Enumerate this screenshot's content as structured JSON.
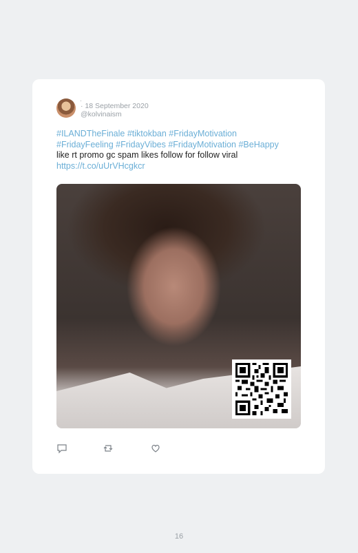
{
  "tweet": {
    "separator": "·",
    "date": "18 September 2020",
    "handle": "@kolvinaism",
    "text_line1": "#ILANDTheFinale #tiktokban #FridayMotivation",
    "text_line2": "#FridayFeeling #FridayVibes #FridayMotivation #BeHappy",
    "text_line3": "like rt promo gc spam likes follow for follow viral",
    "link": "https://t.co/uUrVHcgkcr"
  },
  "actions": {
    "reply_icon": "reply-icon",
    "retweet_icon": "retweet-icon",
    "like_icon": "heart-icon"
  },
  "page": {
    "number": "16"
  }
}
